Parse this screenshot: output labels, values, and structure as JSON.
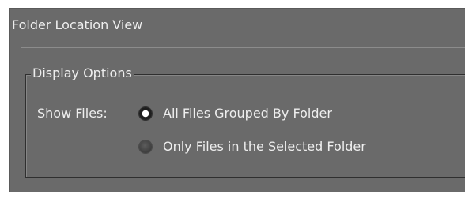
{
  "panel": {
    "title": "Folder Location View"
  },
  "display_options": {
    "legend": "Display Options",
    "show_files_label": "Show Files:",
    "options": [
      {
        "label": "All Files Grouped By Folder",
        "checked": true
      },
      {
        "label": "Only Files in the Selected Folder",
        "checked": false
      }
    ]
  },
  "colors": {
    "panel_background": "#6a6a6a",
    "text": "#eeeeee",
    "rule_dark": "#383838",
    "rule_light": "#8c8c8c"
  }
}
